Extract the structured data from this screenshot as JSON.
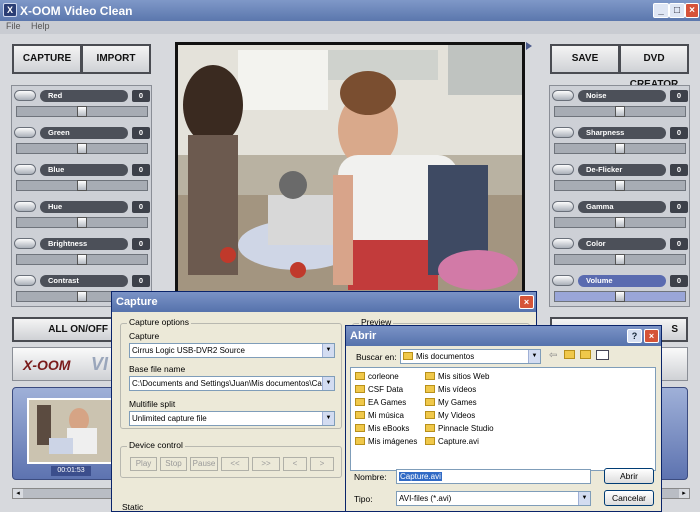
{
  "app": {
    "title": "X-OOM Video Clean",
    "menu": [
      "File",
      "Help"
    ],
    "capture_button": "CAPTURE",
    "import_button": "IMPORT",
    "save_button": "SAVE",
    "dvd_button": "DVD CREATOR",
    "all_onoff": "ALL ON/OFF",
    "brand": "X-OOM",
    "timecode": "00:01:53"
  },
  "left_sliders": [
    {
      "label": "Red",
      "value": "0"
    },
    {
      "label": "Green",
      "value": "0"
    },
    {
      "label": "Blue",
      "value": "0"
    },
    {
      "label": "Hue",
      "value": "0"
    },
    {
      "label": "Brightness",
      "value": "0"
    },
    {
      "label": "Contrast",
      "value": "0"
    }
  ],
  "right_sliders": [
    {
      "label": "Noise",
      "value": "0"
    },
    {
      "label": "Sharpness",
      "value": "0"
    },
    {
      "label": "De-Flicker",
      "value": "0"
    },
    {
      "label": "Gamma",
      "value": "0"
    },
    {
      "label": "Color",
      "value": "0"
    },
    {
      "label": "Volume",
      "value": "0"
    }
  ],
  "capture_dialog": {
    "title": "Capture",
    "options_legend": "Capture options",
    "capture_label": "Capture",
    "capture_value": "Cirrus Logic USB-DVR2 Source",
    "basefile_label": "Base file name",
    "basefile_value": "C:\\Documents and Settings\\Juan\\Mis documentos\\Captur",
    "multifile_label": "Multifile split",
    "multifile_value": "Unlimited capture file",
    "device_legend": "Device control",
    "device_buttons": [
      "Play",
      "Stop",
      "Pause",
      "<<",
      ">>",
      "<",
      ">"
    ],
    "preview_legend": "Preview",
    "static_label": "Static"
  },
  "open_dialog": {
    "title": "Abrir",
    "lookin_label": "Buscar en:",
    "lookin_value": "Mis documentos",
    "files_col1": [
      "corleone",
      "CSF Data",
      "EA Games",
      "Mi música",
      "Mis eBooks",
      "Mis imágenes"
    ],
    "files_col2": [
      "Mis sitios Web",
      "Mis vídeos",
      "My Games",
      "My Videos",
      "Pinnacle Studio",
      "Capture.avi"
    ],
    "name_label": "Nombre:",
    "name_value": "Capture.avi",
    "type_label": "Tipo:",
    "type_value": "AVI-files (*.avi)",
    "open_button": "Abrir",
    "cancel_button": "Cancelar",
    "help_button": "?"
  },
  "colors": {
    "titlebar": "#5b77ad",
    "panel": "#cdd0d6",
    "dialog": "#ece9d8"
  }
}
